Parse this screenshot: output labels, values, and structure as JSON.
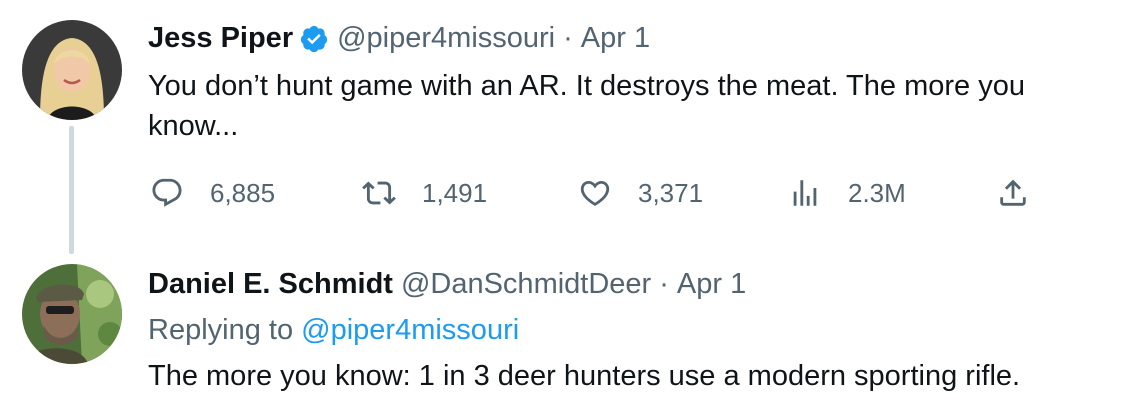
{
  "tweet1": {
    "name": "Jess Piper",
    "handle": "@piper4missouri",
    "separator": "·",
    "date": "Apr 1",
    "text_line1": "You don’t hunt game with an AR. It destroys the meat. The more you",
    "text_line2": "know...",
    "verified": true,
    "stats": {
      "replies": "6,885",
      "retweets": "1,491",
      "likes": "3,371",
      "views": "2.3M"
    }
  },
  "tweet2": {
    "name": "Daniel E. Schmidt",
    "handle": "@DanSchmidtDeer",
    "separator": "·",
    "date": "Apr 1",
    "replying_to_prefix": "Replying to",
    "replying_to_handle": "@piper4missouri",
    "text": "The more you know: 1 in 3 deer hunters use a modern sporting rifle."
  },
  "colors": {
    "text": "#0f1419",
    "muted": "#536471",
    "link": "#1d9bf0",
    "thread_line": "#cfd9de"
  }
}
